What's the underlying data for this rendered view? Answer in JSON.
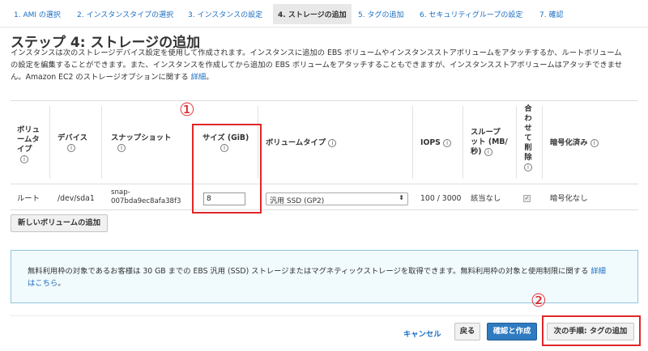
{
  "wizard": {
    "tabs": [
      "1. AMI の選択",
      "2. インスタンスタイプの選択",
      "3. インスタンスの設定",
      "4. ストレージの追加",
      "5. タグの追加",
      "6. セキュリティグループの設定",
      "7. 確認"
    ],
    "active_index": 3
  },
  "page": {
    "title": "ステップ 4: ストレージの追加",
    "description": "インスタンスは次のストレージデバイス設定を使用して作成されます。インスタンスに追加の EBS ボリュームやインスタンスストアボリュームをアタッチするか、ルートボリュームの設定を編集することができます。また、インスタンスを作成してから追加の EBS ボリュームをアタッチすることもできますが、インスタンスストアボリュームはアタッチできません。Amazon EC2 のストレージオプションに関する",
    "description_link": "詳細",
    "description_end": "。"
  },
  "table": {
    "headers": {
      "volume_type_l1": "ボリュ",
      "volume_type_l2": "ームタ",
      "volume_type_l3": "イプ",
      "device": "デバイス",
      "snapshot": "スナップショット",
      "size": "サイズ (GiB)",
      "volume_kind": "ボリュームタイプ",
      "iops": "IOPS",
      "throughput_l1": "スループ",
      "throughput_l2": "ット (MB/",
      "throughput_l3": "秒)",
      "delete_1": "合",
      "delete_2": "わ",
      "delete_3": "せ",
      "delete_4": "て",
      "delete_5": "削",
      "delete_6": "除",
      "encrypted": "暗号化済み",
      "info_glyph": "i"
    },
    "row": {
      "volume_type": "ルート",
      "device": "/dev/sda1",
      "snapshot_l1": "snap-",
      "snapshot_l2": "007bda9ec8afa38f3",
      "size": "8",
      "volume_kind": "汎用 SSD (GP2)",
      "iops": "100 / 3000",
      "throughput": "該当なし",
      "delete_on_termination": true,
      "encrypted": "暗号化なし"
    }
  },
  "actions": {
    "add_volume": "新しいボリュームの追加",
    "cancel": "キャンセル",
    "back": "戻る",
    "review_launch": "確認と作成",
    "next": "次の手順: タグの追加"
  },
  "info_box": {
    "text": "無料利用枠の対象であるお客様は 30 GB までの EBS 汎用 (SSD) ストレージまたはマグネティックストレージを取得できます。無料利用枠の対象と使用制限に関する",
    "link": "詳細はこちら",
    "end": "。"
  },
  "annotations": {
    "marker_1": "①",
    "marker_2": "②",
    "color": "#e0262a"
  }
}
